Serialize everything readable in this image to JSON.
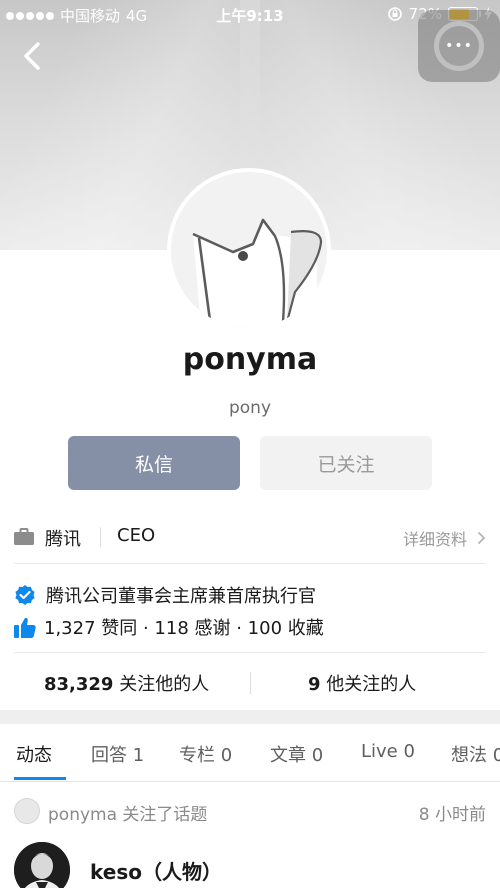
{
  "status_bar": {
    "carrier": "中国移动",
    "network": "4G",
    "time": "上午9:13",
    "battery": "72%",
    "battery_level": 0.72
  },
  "profile": {
    "name": "ponyma",
    "bio": "pony"
  },
  "actions": {
    "message_label": "私信",
    "follow_label": "已关注"
  },
  "job": {
    "company": "腾讯",
    "title": "CEO",
    "detail_label": "详细资料"
  },
  "verification": {
    "text": "腾讯公司董事会主席兼首席执行官"
  },
  "stats": {
    "text": "1,327 赞同 · 118 感谢 · 100 收藏"
  },
  "follow": {
    "followers_count": "83,329",
    "followers_label": "关注他的人",
    "following_count": "9",
    "following_label": "他关注的人"
  },
  "tabs": [
    {
      "label": "动态"
    },
    {
      "label": "回答 1"
    },
    {
      "label": "专栏 0"
    },
    {
      "label": "文章 0"
    },
    {
      "label": "Live 0"
    },
    {
      "label": "想法 0"
    }
  ],
  "activity": {
    "text": "ponyma 关注了话题",
    "time": "8 小时前",
    "topic_title": "keso（人物）"
  },
  "colors": {
    "accent": "#0f88eb",
    "message_button": "#8590a6",
    "battery": "#f3b700"
  },
  "icons": {
    "back": "chevron-left-icon",
    "floating": "assistive-touch-icon",
    "job": "briefcase-icon",
    "verified": "verified-badge-icon",
    "likes": "thumbs-up-icon",
    "detail": "chevron-right-icon"
  }
}
